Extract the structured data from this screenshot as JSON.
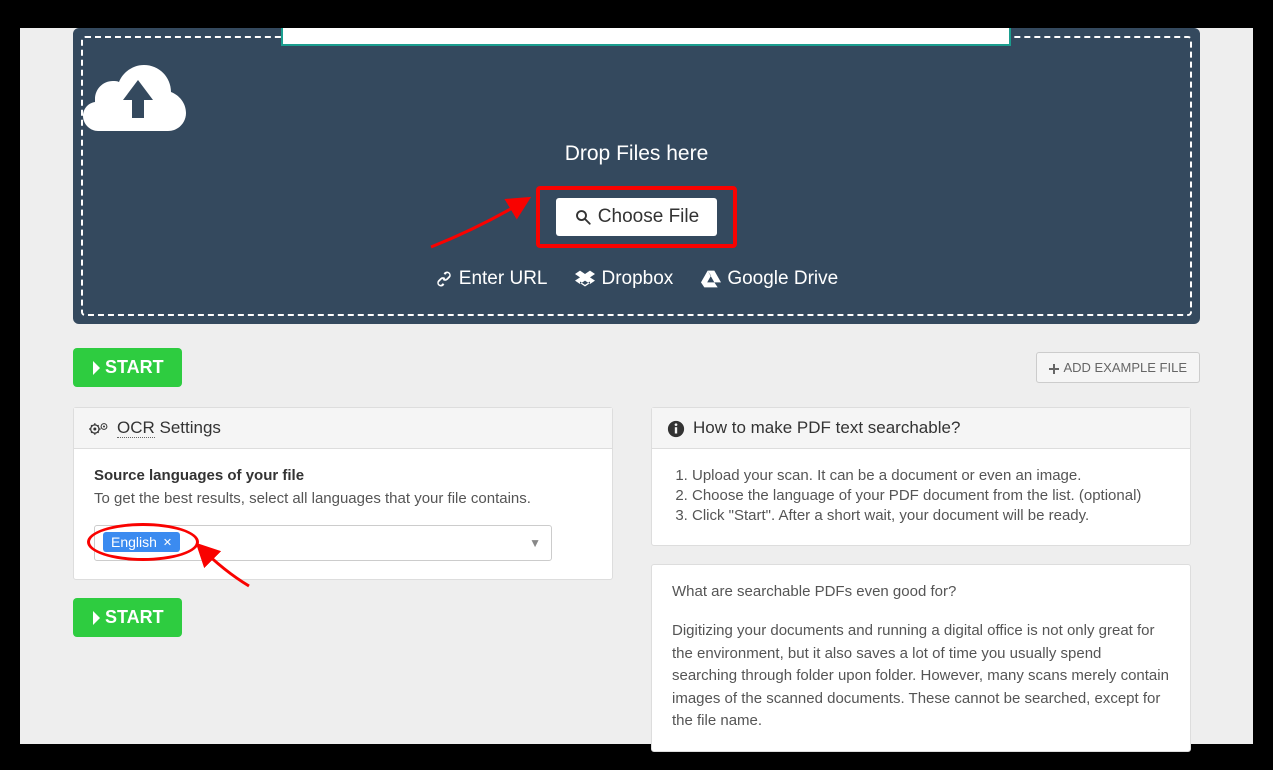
{
  "dropzone": {
    "label": "Drop Files here",
    "choose_button": "Choose File",
    "sources": {
      "url": "Enter URL",
      "dropbox": "Dropbox",
      "gdrive": "Google Drive"
    }
  },
  "actions": {
    "start": "START",
    "add_example": "ADD EXAMPLE FILE"
  },
  "ocr_panel": {
    "title_prefix": "OCR",
    "title_suffix": " Settings",
    "source_lang_heading": "Source languages of your file",
    "source_lang_desc": "To get the best results, select all languages that your file contains.",
    "selected_language": "English"
  },
  "howto_panel": {
    "title": "How to make PDF text searchable?",
    "steps": [
      "Upload your scan. It can be a document or even an image.",
      "Choose the language of your PDF document from the list. (optional)",
      "Click \"Start\". After a short wait, your document will be ready."
    ]
  },
  "info_panel": {
    "heading": "What are searchable PDFs even good for?",
    "body": "Digitizing your documents and running a digital office is not only great for the environment, but it also saves a lot of time you usually spend searching through folder upon folder. However, many scans merely contain images of the scanned documents. These cannot be searched, except for the file name."
  }
}
